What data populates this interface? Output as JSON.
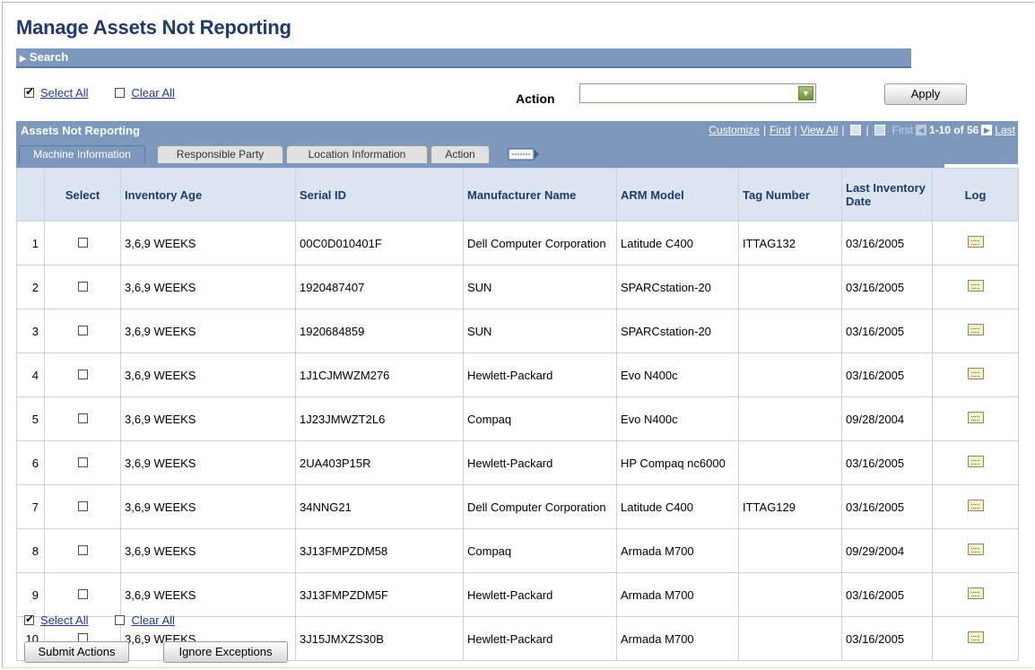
{
  "page_title": "Manage Assets Not Reporting",
  "search": {
    "label": "Search"
  },
  "top_select": {
    "select_all": "Select All",
    "clear_all": "Clear All"
  },
  "action": {
    "label": "Action",
    "value": "",
    "apply": "Apply"
  },
  "grid": {
    "title": "Assets Not Reporting",
    "nav": {
      "customize": "Customize",
      "find": "Find",
      "view_all": "View All",
      "first": "First",
      "range": "1-10 of 56",
      "last": "Last"
    },
    "tabs": [
      "Machine Information",
      "Responsible Party",
      "Location Information",
      "Action"
    ],
    "columns": [
      "Select",
      "Inventory Age",
      "Serial ID",
      "Manufacturer Name",
      "ARM Model",
      "Tag Number",
      "Last Inventory Date",
      "Log"
    ],
    "rows": [
      {
        "num": "1",
        "age": "3,6,9 WEEKS",
        "serial": "00C0D010401F",
        "mfr": "Dell Computer Corporation",
        "model": "Latitude C400",
        "tag": "ITTAG132",
        "date": "03/16/2005"
      },
      {
        "num": "2",
        "age": "3,6,9 WEEKS",
        "serial": "1920487407",
        "mfr": "SUN",
        "model": "SPARCstation-20",
        "tag": "",
        "date": "03/16/2005"
      },
      {
        "num": "3",
        "age": "3,6,9 WEEKS",
        "serial": "1920684859",
        "mfr": "SUN",
        "model": "SPARCstation-20",
        "tag": "",
        "date": "03/16/2005"
      },
      {
        "num": "4",
        "age": "3,6,9 WEEKS",
        "serial": "1J1CJMWZM276",
        "mfr": "Hewlett-Packard",
        "model": "Evo N400c",
        "tag": "",
        "date": "03/16/2005"
      },
      {
        "num": "5",
        "age": "3,6,9 WEEKS",
        "serial": "1J23JMWZT2L6",
        "mfr": "Compaq",
        "model": "Evo N400c",
        "tag": "",
        "date": "09/28/2004"
      },
      {
        "num": "6",
        "age": "3,6,9 WEEKS",
        "serial": "2UA403P15R",
        "mfr": "Hewlett-Packard",
        "model": "HP Compaq nc6000",
        "tag": "",
        "date": "03/16/2005"
      },
      {
        "num": "7",
        "age": "3,6,9 WEEKS",
        "serial": "34NNG21",
        "mfr": "Dell Computer Corporation",
        "model": "Latitude C400",
        "tag": "ITTAG129",
        "date": "03/16/2005"
      },
      {
        "num": "8",
        "age": "3,6,9 WEEKS",
        "serial": "3J13FMPZDM58",
        "mfr": "Compaq",
        "model": "Armada M700",
        "tag": "",
        "date": "09/29/2004"
      },
      {
        "num": "9",
        "age": "3,6,9 WEEKS",
        "serial": "3J13FMPZDM5F",
        "mfr": "Hewlett-Packard",
        "model": "Armada M700",
        "tag": "",
        "date": "03/16/2005"
      },
      {
        "num": "10",
        "age": "3,6,9 WEEKS",
        "serial": "3J15JMXZS30B",
        "mfr": "Hewlett-Packard",
        "model": "Armada M700",
        "tag": "",
        "date": "03/16/2005"
      }
    ]
  },
  "bottom_select": {
    "select_all": "Select All",
    "clear_all": "Clear All"
  },
  "buttons": {
    "submit": "Submit Actions",
    "ignore": "Ignore Exceptions"
  },
  "icons": {
    "log": "log-note-icon",
    "expand": "triangle-right-icon",
    "dropdown": "chevron-down-icon",
    "show_all_tabs": "show-all-columns-icon",
    "zoom": "zoom-icon",
    "download": "download-grid-icon"
  }
}
